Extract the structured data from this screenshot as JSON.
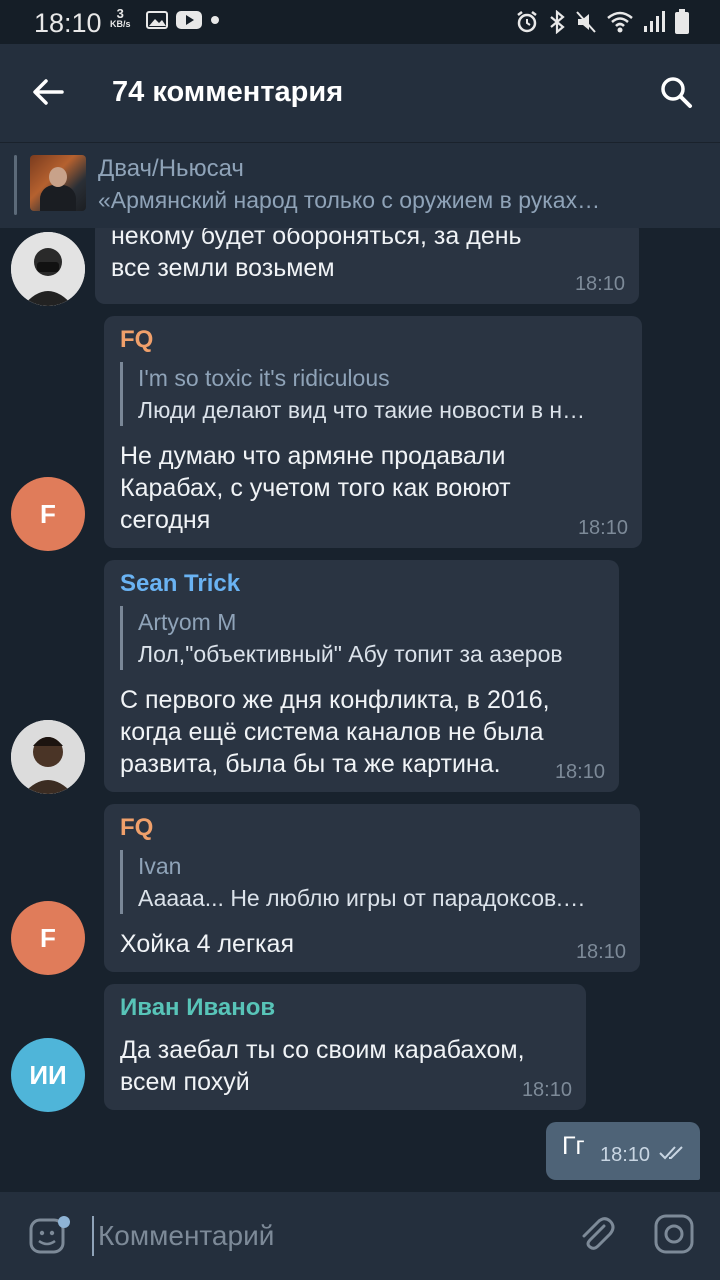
{
  "statusbar": {
    "time": "18:10",
    "speed_value": "3",
    "speed_unit": "KB/s"
  },
  "header": {
    "title": "74 комментария"
  },
  "pinned": {
    "channel": "Двач/Ньюсач",
    "text": "«Армянский народ только с оружием в руках…"
  },
  "messages": [
    {
      "text": "некому будет обороняться, за день\nвсе земли возьмем",
      "time": "18:10"
    },
    {
      "sender": "FQ",
      "sender_color": "#f0a06b",
      "avatar_letter": "F",
      "avatar_color": "#e07c5a",
      "reply_name": "I'm so toxic it's ridiculous",
      "reply_text": "Люди делают вид что такие новости в н…",
      "text": "Не думаю что армяне продавали\nКарабах, с учетом того как воюют\nсегодня",
      "time": "18:10"
    },
    {
      "sender": "Sean Trick",
      "sender_color": "#6ab3f3",
      "reply_name": "Artyom M",
      "reply_text": "Лол,\"объективный\" Абу топит за азеров",
      "text": "С первого же дня конфликта, в 2016,\nкогда ещё система каналов не была\nразвита, была бы та же картина.",
      "time": "18:10"
    },
    {
      "sender": "FQ",
      "sender_color": "#f0a06b",
      "avatar_letter": "F",
      "avatar_color": "#e07c5a",
      "reply_name": "Ivan",
      "reply_text": "Ааааа... Не люблю игры от парадоксов.…",
      "text": "Хойка 4 легкая",
      "time": "18:10"
    },
    {
      "sender": "Иван Иванов",
      "sender_color": "#58c4b8",
      "avatar_letter": "ИИ",
      "avatar_color": "#4fb5d9",
      "text": "Да заебал ты со своим карабахом,\nвсем похуй",
      "time": "18:10"
    }
  ],
  "outgoing": {
    "text": "Гг",
    "time": "18:10"
  },
  "composer": {
    "placeholder": "Комментарий"
  },
  "colors": {
    "appbar": "#242f3d",
    "chat_bg": "#18222d",
    "bubble_in": "#2a3442",
    "bubble_out": "#4e6377"
  }
}
